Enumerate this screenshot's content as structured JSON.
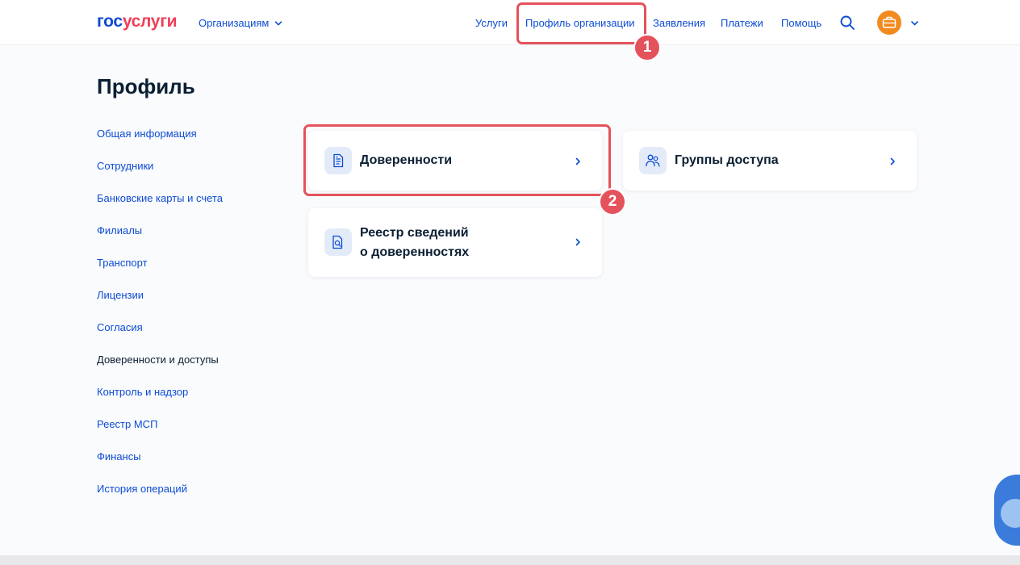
{
  "header": {
    "logo": {
      "part1": "гос",
      "part2": "услуги"
    },
    "org_menu_label": "Организациям",
    "nav": [
      "Услуги",
      "Профиль организации",
      "Заявления",
      "Платежи",
      "Помощь"
    ]
  },
  "annotations": {
    "badge1": "1",
    "badge2": "2"
  },
  "page": {
    "title": "Профиль"
  },
  "sidebar": {
    "items": [
      "Общая информация",
      "Сотрудники",
      "Банковские карты и счета",
      "Филиалы",
      "Транспорт",
      "Лицензии",
      "Согласия",
      "Доверенности и доступы",
      "Контроль и надзор",
      "Реестр МСП",
      "Финансы",
      "История операций"
    ],
    "active_index": 7
  },
  "cards": {
    "powers_of_attorney": {
      "title": "Доверенности"
    },
    "access_groups": {
      "title": "Группы доступа"
    },
    "registry": {
      "title_line1": "Реестр сведений",
      "title_line2": "о доверенностях"
    }
  },
  "colors": {
    "link": "#0d4cd3",
    "text": "#0b1f33",
    "highlight": "#e4525c",
    "logo_red": "#ee3f58",
    "avatar": "#f28a1f",
    "icon_bg": "#e3ebf9"
  }
}
